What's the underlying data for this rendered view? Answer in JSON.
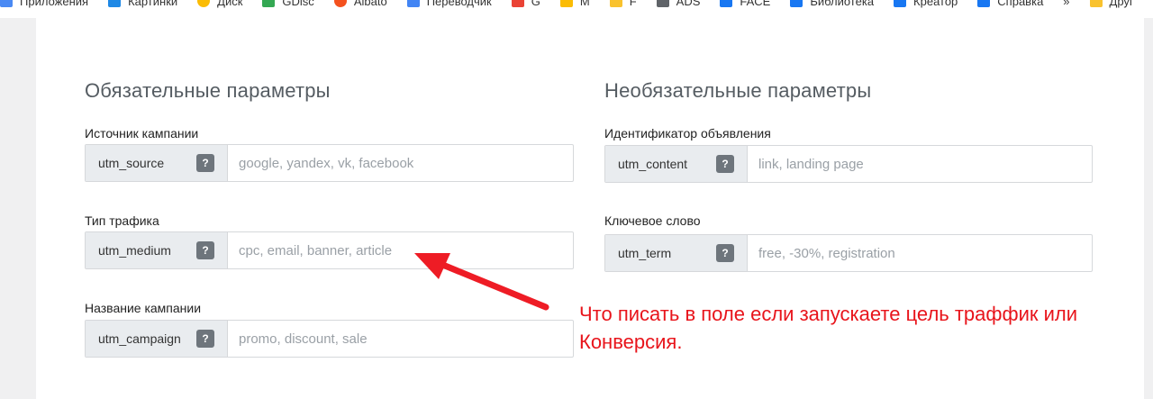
{
  "bookmarks": [
    {
      "label": "Приложения",
      "color": "#4a8af4",
      "icon": "apps-icon"
    },
    {
      "label": "Картинки",
      "color": "#1e88e5",
      "icon": "pin-icon"
    },
    {
      "label": "Диск",
      "color": "#fbbc04",
      "icon": "drive-icon"
    },
    {
      "label": "GDisc",
      "color": "#34a853",
      "icon": "drive-icon"
    },
    {
      "label": "Albato",
      "color": "#f4511e",
      "icon": "albato-icon"
    },
    {
      "label": "Переводчик",
      "color": "#4285f4",
      "icon": "translate-icon"
    },
    {
      "label": "G",
      "color": "#ea4335",
      "icon": "gmail-icon"
    },
    {
      "label": "M",
      "color": "#fbbc04",
      "icon": "m-icon"
    },
    {
      "label": "F",
      "color": "#f9c22e",
      "icon": "folder-icon"
    },
    {
      "label": "ADS",
      "color": "#5f6368",
      "icon": "ads-icon"
    },
    {
      "label": "FACE",
      "color": "#1877f2",
      "icon": "facebook-icon"
    },
    {
      "label": "Библиотека",
      "color": "#1877f2",
      "icon": "facebook-icon"
    },
    {
      "label": "Креатор",
      "color": "#1877f2",
      "icon": "facebook-icon"
    },
    {
      "label": "Справка",
      "color": "#1877f2",
      "icon": "facebook-icon"
    }
  ],
  "bookmarks_overflow": "»",
  "bookmarks_other": "Друг",
  "required": {
    "title": "Обязательные параметры",
    "fields": [
      {
        "label": "Источник кампании",
        "param": "utm_source",
        "help": "?",
        "placeholder": "google, yandex, vk, facebook"
      },
      {
        "label": "Тип трафика",
        "param": "utm_medium",
        "help": "?",
        "placeholder": "cpc, email, banner, article"
      },
      {
        "label": "Название кампании",
        "param": "utm_campaign",
        "help": "?",
        "placeholder": "promo, discount, sale"
      }
    ]
  },
  "optional": {
    "title": "Необязательные параметры",
    "fields": [
      {
        "label": "Идентификатор объявления",
        "param": "utm_content",
        "help": "?",
        "placeholder": "link, landing page"
      },
      {
        "label": "Ключевое слово",
        "param": "utm_term",
        "help": "?",
        "placeholder": "free, -30%, registration"
      }
    ]
  },
  "annotation": {
    "text": "Что писать в поле если запускаете цель траффик или Конверсия.",
    "color": "#e8141b"
  }
}
